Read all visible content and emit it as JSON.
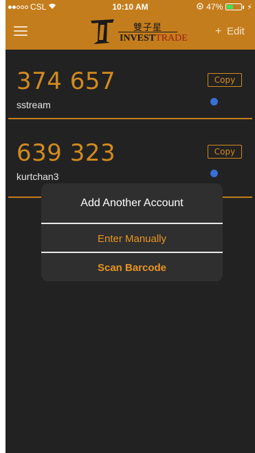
{
  "status_bar": {
    "carrier": "CSL",
    "time": "10:10 AM",
    "battery_percent": "47%",
    "battery_level": 0.47
  },
  "nav": {
    "menu_icon": "hamburger-menu-icon",
    "logo_chinese": "雙子星",
    "logo_invest": "INVEST",
    "logo_trade": "TRADE",
    "add_icon": "+",
    "edit_label": "Edit"
  },
  "accounts": [
    {
      "code": "374 657",
      "name": "sstream",
      "copy_label": "Copy"
    },
    {
      "code": "639 323",
      "name": "kurtchan3",
      "copy_label": "Copy"
    }
  ],
  "action_sheet": {
    "title": "Add Another Account",
    "manual_label": "Enter Manually",
    "scan_label": "Scan Barcode"
  },
  "colors": {
    "accent": "#c47d1c",
    "code_text": "#d28b1f",
    "background": "#222222",
    "timer_dot": "#3a6fd4"
  }
}
